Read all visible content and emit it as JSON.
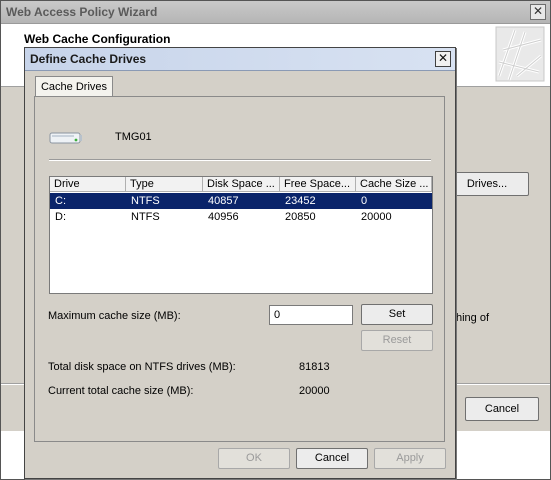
{
  "wizard": {
    "title": "Web Access Policy Wizard",
    "close_glyph": "✕",
    "header_title": "Web Cache Configuration",
    "drives_button": "Drives...",
    "partial_text": "hing of",
    "cancel_button": "Cancel"
  },
  "dialog": {
    "title": "Define Cache Drives",
    "close_glyph": "✕",
    "tab_label": "Cache Drives",
    "server_icon": "server-icon",
    "server_name": "TMG01",
    "columns": [
      "Drive",
      "Type",
      "Disk Space ...",
      "Free Space...",
      "Cache Size ..."
    ],
    "rows": [
      {
        "drive": "C:",
        "type": "NTFS",
        "disk_space": "40857",
        "free_space": "23452",
        "cache_size": "0",
        "selected": true
      },
      {
        "drive": "D:",
        "type": "NTFS",
        "disk_space": "40956",
        "free_space": "20850",
        "cache_size": "20000",
        "selected": false
      }
    ],
    "max_cache_label": "Maximum cache size (MB):",
    "max_cache_value": "0",
    "set_button": "Set",
    "reset_button": "Reset",
    "total_disk_label": "Total disk space on NTFS drives (MB):",
    "total_disk_value": "81813",
    "current_cache_label": "Current total cache size (MB):",
    "current_cache_value": "20000",
    "ok_button": "OK",
    "cancel_button": "Cancel",
    "apply_button": "Apply"
  },
  "colors": {
    "selection": "#0a246a",
    "dialog_face": "#d4d0c8",
    "title_gradient": "#c7d4ea"
  }
}
